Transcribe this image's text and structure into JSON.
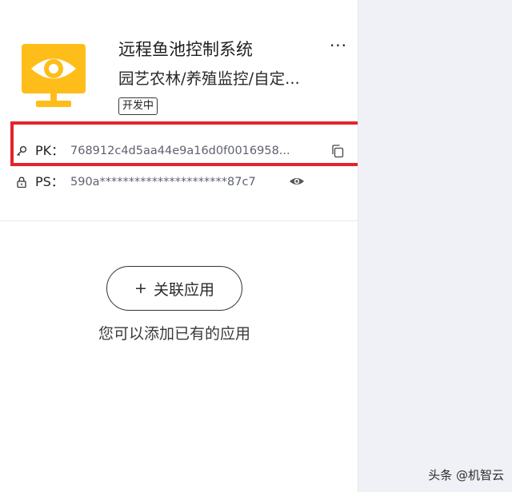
{
  "product": {
    "icon": "monitor-eye-icon",
    "name": "远程鱼池控制系统",
    "category": "园艺农林/养殖监控/自定...",
    "status": "开发中",
    "more": "···"
  },
  "keys": {
    "pk_label": "PK：",
    "pk_value": "768912c4d5aa44e9a16d0f0016958...",
    "ps_label": "PS：",
    "ps_value": "590a**********************87c7"
  },
  "apps": {
    "link_button_label": "关联应用",
    "link_button_prefix": "+",
    "empty_hint": "您可以添加已有的应用"
  },
  "watermark": "头条 @机智云",
  "colors": {
    "highlight": "#e3232d",
    "icon_yellow": "#ffbd1a",
    "side_background": "#eff1f6"
  }
}
